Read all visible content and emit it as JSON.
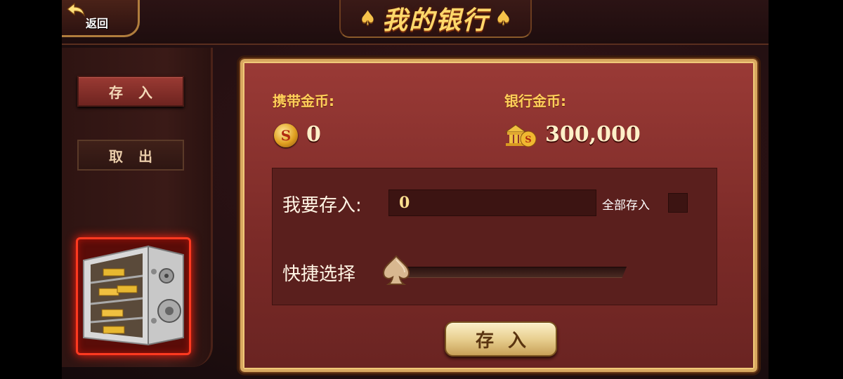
{
  "header": {
    "back_label": "返回",
    "title": "我的银行",
    "title_decoration_left": "♠",
    "title_decoration_right": "♠"
  },
  "sidebar": {
    "tabs": [
      {
        "label": "存入",
        "active": true
      },
      {
        "label": "取出",
        "active": false
      }
    ],
    "illustration": "safe-with-gold-bars"
  },
  "balances": {
    "carried_label": "携带金币:",
    "carried_value": "0",
    "bank_label": "银行金币:",
    "bank_value": "300,000"
  },
  "deposit_form": {
    "amount_label": "我要存入:",
    "amount_value": "0",
    "deposit_all_label": "全部存入",
    "deposit_all_checked": false,
    "quick_select_label": "快捷选择",
    "quick_select_level": 0,
    "submit_label": "存入"
  },
  "colors": {
    "gold_text": "#ffcf5a",
    "panel_red": "#8a302d",
    "frame_gold": "#d8a860"
  }
}
